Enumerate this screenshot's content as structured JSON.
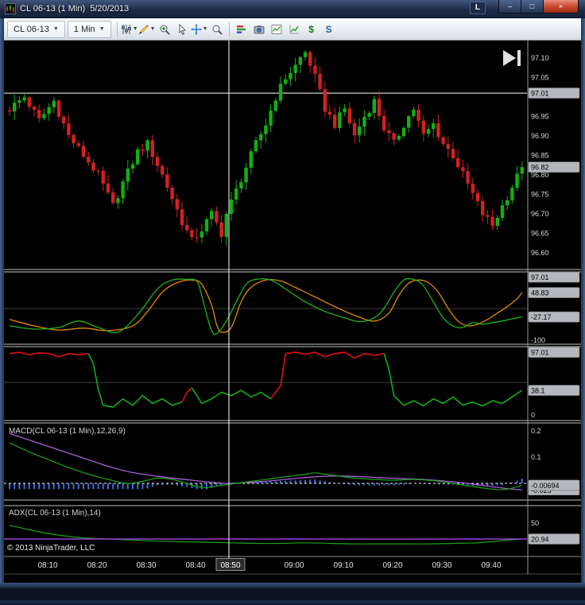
{
  "window": {
    "title": "CL 06-13 (1 Min)  5/20/2013",
    "l_button": "L",
    "controls": {
      "minimize": "–",
      "maximize": "□",
      "close": "×"
    }
  },
  "toolbar": {
    "instrument": "CL 06-13",
    "interval": "1 Min",
    "dollar_label": "$",
    "s_label": "S"
  },
  "icons": {
    "titlebar": [
      "app-chart-icon",
      "minimize",
      "maximize",
      "close"
    ],
    "toolbar": [
      "chart-style",
      "drawing-tools",
      "zoom-in",
      "cursor",
      "crosshair",
      "data-box",
      "chart-trader",
      "snapshot",
      "chart-image",
      "indicators",
      "dollar",
      "strategy"
    ],
    "chart": [
      "go-to-last-bar"
    ]
  },
  "price_axis": {
    "labels": [
      "97.10",
      "97.05",
      "96.95",
      "96.90",
      "96.85",
      "96.80",
      "96.75",
      "96.70",
      "96.65",
      "96.60"
    ],
    "crosshair_tag": "97.01",
    "last_price_tag": "96.82"
  },
  "stoch_axis": {
    "bottom_label": "-100",
    "tags": [
      "97.01",
      "48.83",
      "-27.17"
    ]
  },
  "trend_axis": {
    "bottom_label": "0",
    "tags": [
      "97.01",
      "38.1"
    ]
  },
  "macd_panel": {
    "label": "MACD(CL 06-13 (1 Min),12,26,9)",
    "axis_labels": [
      "0.2",
      "0.1"
    ],
    "tags": [
      "-0.00694",
      "-0.025"
    ]
  },
  "adx_panel": {
    "label": "ADX(CL 06-13 (1 Min),14)",
    "axis_labels": [
      "50"
    ],
    "tags": [
      "20.94"
    ]
  },
  "time_axis": {
    "labels": [
      "08:10",
      "08:20",
      "08:30",
      "08:40",
      "09:00",
      "09:10",
      "09:20",
      "09:30",
      "09:40"
    ],
    "crosshair_marker": "08:50"
  },
  "footer": {
    "copyright": "© 2013 NinjaTrader, LLC"
  },
  "colors": {
    "up": "#12b012",
    "down": "#d42020",
    "stoch_fast": "#1db31d",
    "stoch_slow": "#e08a00",
    "trend_up": "#12b012",
    "trend_down": "#e01010",
    "macd_line": "#1aa51a",
    "macd_avg": "#a85fd6",
    "histogram": "#3b6fd4",
    "adx_line": "#1aa51a",
    "adx_threshold": "#9940d4",
    "tag_bg": "#b4b8bc",
    "crosshair": "#ffffff"
  },
  "chart_data": {
    "type": "candlestick",
    "title": "CL 06-13 (1 Min) 5/20/2013",
    "x_axis": "time, 1-min bars 08:06 - 09:50",
    "price_range": [
      96.6,
      97.1
    ],
    "price_keypoints": [
      [
        0,
        96.97
      ],
      [
        3,
        97.0
      ],
      [
        6,
        96.94
      ],
      [
        9,
        96.99
      ],
      [
        12,
        96.9
      ],
      [
        15,
        96.85
      ],
      [
        18,
        96.8
      ],
      [
        21,
        96.72
      ],
      [
        23,
        96.78
      ],
      [
        26,
        96.86
      ],
      [
        28,
        96.88
      ],
      [
        31,
        96.8
      ],
      [
        33,
        96.74
      ],
      [
        35,
        96.68
      ],
      [
        37,
        96.63
      ],
      [
        39,
        96.66
      ],
      [
        41,
        96.7
      ],
      [
        43,
        96.65
      ],
      [
        44,
        96.7
      ],
      [
        46,
        96.76
      ],
      [
        48,
        96.82
      ],
      [
        50,
        96.88
      ],
      [
        52,
        96.93
      ],
      [
        54,
        97.0
      ],
      [
        56,
        97.05
      ],
      [
        58,
        97.08
      ],
      [
        60,
        97.12
      ],
      [
        62,
        97.05
      ],
      [
        64,
        96.97
      ],
      [
        66,
        96.93
      ],
      [
        68,
        96.97
      ],
      [
        70,
        96.9
      ],
      [
        72,
        96.95
      ],
      [
        74,
        96.99
      ],
      [
        76,
        96.92
      ],
      [
        78,
        96.88
      ],
      [
        80,
        96.93
      ],
      [
        82,
        96.97
      ],
      [
        84,
        96.9
      ],
      [
        86,
        96.93
      ],
      [
        88,
        96.88
      ],
      [
        90,
        96.85
      ],
      [
        92,
        96.8
      ],
      [
        94,
        96.75
      ],
      [
        96,
        96.7
      ],
      [
        98,
        96.67
      ],
      [
        100,
        96.72
      ],
      [
        102,
        96.77
      ],
      [
        104,
        96.82
      ]
    ],
    "stoch_range": [
      -100,
      100
    ],
    "stoch_green": [
      [
        0,
        -55
      ],
      [
        5,
        -65
      ],
      [
        10,
        -60
      ],
      [
        14,
        -40
      ],
      [
        18,
        -60
      ],
      [
        22,
        -75
      ],
      [
        26,
        -20
      ],
      [
        30,
        60
      ],
      [
        33,
        88
      ],
      [
        36,
        90
      ],
      [
        38,
        85
      ],
      [
        39,
        40
      ],
      [
        40,
        -20
      ],
      [
        41,
        -70
      ],
      [
        42,
        -80
      ],
      [
        44,
        -40
      ],
      [
        46,
        20
      ],
      [
        48,
        75
      ],
      [
        50,
        90
      ],
      [
        53,
        88
      ],
      [
        56,
        60
      ],
      [
        60,
        20
      ],
      [
        64,
        -10
      ],
      [
        68,
        -30
      ],
      [
        71,
        -42
      ],
      [
        74,
        -30
      ],
      [
        76,
        0
      ],
      [
        78,
        50
      ],
      [
        80,
        88
      ],
      [
        82,
        90
      ],
      [
        84,
        70
      ],
      [
        86,
        20
      ],
      [
        88,
        -30
      ],
      [
        90,
        -55
      ],
      [
        92,
        -60
      ],
      [
        94,
        -45
      ],
      [
        96,
        -50
      ],
      [
        98,
        -45
      ],
      [
        100,
        -40
      ],
      [
        102,
        -33
      ],
      [
        104,
        -27.17
      ]
    ],
    "stoch_orange": [
      [
        0,
        -35
      ],
      [
        5,
        -55
      ],
      [
        10,
        -68
      ],
      [
        15,
        -62
      ],
      [
        20,
        -70
      ],
      [
        25,
        -55
      ],
      [
        28,
        -10
      ],
      [
        31,
        50
      ],
      [
        34,
        80
      ],
      [
        37,
        88
      ],
      [
        39,
        75
      ],
      [
        41,
        10
      ],
      [
        42,
        -50
      ],
      [
        43,
        -75
      ],
      [
        45,
        -60
      ],
      [
        47,
        20
      ],
      [
        49,
        65
      ],
      [
        52,
        88
      ],
      [
        55,
        85
      ],
      [
        58,
        65
      ],
      [
        62,
        35
      ],
      [
        66,
        5
      ],
      [
        70,
        -22
      ],
      [
        74,
        -40
      ],
      [
        77,
        -15
      ],
      [
        79,
        40
      ],
      [
        81,
        78
      ],
      [
        83,
        88
      ],
      [
        85,
        80
      ],
      [
        87,
        50
      ],
      [
        89,
        0
      ],
      [
        91,
        -40
      ],
      [
        93,
        -55
      ],
      [
        95,
        -50
      ],
      [
        97,
        -35
      ],
      [
        99,
        -15
      ],
      [
        101,
        5
      ],
      [
        103,
        30
      ],
      [
        104,
        48.83
      ]
    ],
    "trend_range": [
      0,
      100
    ],
    "trend_points": [
      [
        0,
        95,
        "r"
      ],
      [
        2,
        97,
        "r"
      ],
      [
        4,
        93,
        "r"
      ],
      [
        6,
        96,
        "r"
      ],
      [
        8,
        95,
        "r"
      ],
      [
        10,
        90,
        "r"
      ],
      [
        12,
        95,
        "r"
      ],
      [
        14,
        93,
        "r"
      ],
      [
        16,
        95,
        "r"
      ],
      [
        17,
        80,
        "g"
      ],
      [
        18,
        40,
        "g"
      ],
      [
        19,
        15,
        "g"
      ],
      [
        21,
        12,
        "g"
      ],
      [
        23,
        25,
        "g"
      ],
      [
        25,
        15,
        "g"
      ],
      [
        27,
        30,
        "g"
      ],
      [
        29,
        18,
        "g"
      ],
      [
        31,
        25,
        "g"
      ],
      [
        33,
        15,
        "g"
      ],
      [
        35,
        20,
        "g"
      ],
      [
        36,
        35,
        "r"
      ],
      [
        37,
        42,
        "r"
      ],
      [
        38,
        30,
        "g"
      ],
      [
        39,
        18,
        "g"
      ],
      [
        41,
        25,
        "g"
      ],
      [
        43,
        35,
        "g"
      ],
      [
        45,
        30,
        "g"
      ],
      [
        47,
        38,
        "g"
      ],
      [
        49,
        28,
        "g"
      ],
      [
        51,
        35,
        "g"
      ],
      [
        53,
        25,
        "g"
      ],
      [
        55,
        45,
        "r"
      ],
      [
        56,
        95,
        "r"
      ],
      [
        58,
        97,
        "r"
      ],
      [
        60,
        94,
        "r"
      ],
      [
        62,
        97,
        "r"
      ],
      [
        64,
        90,
        "r"
      ],
      [
        66,
        95,
        "r"
      ],
      [
        68,
        97,
        "r"
      ],
      [
        70,
        88,
        "r"
      ],
      [
        72,
        95,
        "r"
      ],
      [
        74,
        92,
        "r"
      ],
      [
        76,
        95,
        "r"
      ],
      [
        77,
        70,
        "g"
      ],
      [
        78,
        30,
        "g"
      ],
      [
        80,
        15,
        "g"
      ],
      [
        82,
        22,
        "g"
      ],
      [
        84,
        14,
        "g"
      ],
      [
        86,
        25,
        "g"
      ],
      [
        88,
        18,
        "g"
      ],
      [
        90,
        28,
        "g"
      ],
      [
        92,
        15,
        "g"
      ],
      [
        94,
        20,
        "g"
      ],
      [
        96,
        14,
        "g"
      ],
      [
        98,
        22,
        "g"
      ],
      [
        100,
        18,
        "g"
      ],
      [
        102,
        28,
        "g"
      ],
      [
        104,
        38.1,
        "g"
      ]
    ],
    "macd_line": [
      [
        0,
        0.155
      ],
      [
        4,
        0.12
      ],
      [
        8,
        0.09
      ],
      [
        12,
        0.06
      ],
      [
        16,
        0.035
      ],
      [
        20,
        0.015
      ],
      [
        24,
        0.0
      ],
      [
        28,
        0.012
      ],
      [
        30,
        0.02
      ],
      [
        33,
        0.015
      ],
      [
        36,
        0.0
      ],
      [
        38,
        -0.012
      ],
      [
        40,
        -0.016
      ],
      [
        42,
        -0.01
      ],
      [
        46,
        0.0
      ],
      [
        50,
        0.01
      ],
      [
        54,
        0.02
      ],
      [
        58,
        0.03
      ],
      [
        60,
        0.035
      ],
      [
        62,
        0.04
      ],
      [
        64,
        0.035
      ],
      [
        66,
        0.03
      ],
      [
        70,
        0.02
      ],
      [
        74,
        0.015
      ],
      [
        78,
        0.012
      ],
      [
        82,
        0.015
      ],
      [
        86,
        0.01
      ],
      [
        90,
        0.0
      ],
      [
        94,
        -0.012
      ],
      [
        98,
        -0.022
      ],
      [
        100,
        -0.024
      ],
      [
        102,
        -0.018
      ],
      [
        104,
        -0.00694
      ]
    ],
    "macd_avg": [
      [
        0,
        0.19
      ],
      [
        4,
        0.165
      ],
      [
        8,
        0.14
      ],
      [
        12,
        0.115
      ],
      [
        16,
        0.09
      ],
      [
        20,
        0.065
      ],
      [
        24,
        0.045
      ],
      [
        28,
        0.032
      ],
      [
        32,
        0.022
      ],
      [
        36,
        0.014
      ],
      [
        40,
        0.006
      ],
      [
        44,
        0.0
      ],
      [
        48,
        0.003
      ],
      [
        52,
        0.008
      ],
      [
        56,
        0.015
      ],
      [
        60,
        0.022
      ],
      [
        64,
        0.027
      ],
      [
        68,
        0.028
      ],
      [
        72,
        0.025
      ],
      [
        76,
        0.021
      ],
      [
        80,
        0.018
      ],
      [
        84,
        0.015
      ],
      [
        88,
        0.009
      ],
      [
        92,
        0.002
      ],
      [
        96,
        -0.008
      ],
      [
        100,
        -0.018
      ],
      [
        104,
        -0.025
      ]
    ],
    "adx_line": [
      [
        0,
        46
      ],
      [
        3,
        40
      ],
      [
        6,
        34
      ],
      [
        10,
        28
      ],
      [
        15,
        23
      ],
      [
        20,
        21
      ],
      [
        25,
        19
      ],
      [
        30,
        17
      ],
      [
        35,
        16
      ],
      [
        40,
        15
      ],
      [
        45,
        14
      ],
      [
        50,
        13
      ],
      [
        55,
        13
      ],
      [
        60,
        14
      ],
      [
        65,
        13
      ],
      [
        70,
        12
      ],
      [
        75,
        12
      ],
      [
        80,
        12
      ],
      [
        85,
        12
      ],
      [
        90,
        13
      ],
      [
        95,
        14
      ],
      [
        100,
        18
      ],
      [
        104,
        20.94
      ]
    ],
    "adx_threshold": 20.94
  }
}
